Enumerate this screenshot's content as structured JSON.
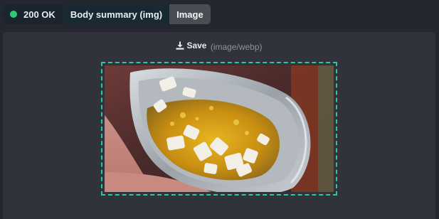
{
  "tabs": {
    "status": "200 OK",
    "summary": "Body summary (img)",
    "image": "Image"
  },
  "status_color": "#2ecc71",
  "save": {
    "label": "Save",
    "mime": "(image/webp)"
  },
  "accent_color": "#2fc79a",
  "icons": {
    "download": "download-icon"
  }
}
